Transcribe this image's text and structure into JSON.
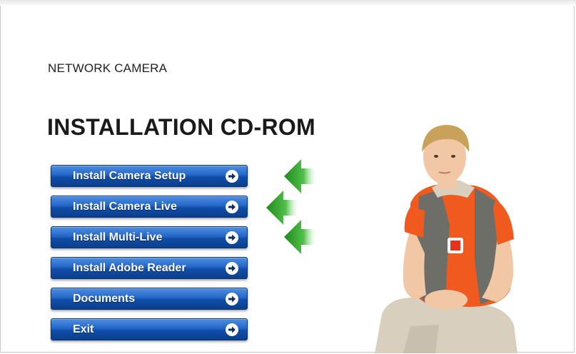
{
  "header": {
    "subtitle": "NETWORK CAMERA",
    "title": "INSTALLATION CD-ROM"
  },
  "menu": {
    "items": [
      {
        "label": "Install Camera Setup",
        "icon": "arrow-right-icon"
      },
      {
        "label": "Install Camera Live",
        "icon": "arrow-right-icon"
      },
      {
        "label": "Install Multi-Live",
        "icon": "arrow-right-icon"
      },
      {
        "label": "Install Adobe Reader",
        "icon": "arrow-right-icon"
      },
      {
        "label": "Documents",
        "icon": "arrow-right-icon"
      },
      {
        "label": "Exit",
        "icon": "arrow-right-icon"
      }
    ]
  },
  "decorations": {
    "green_arrows": [
      "green-arrow-left-icon",
      "green-arrow-left-icon",
      "green-arrow-left-icon"
    ],
    "photo": "boy-portrait"
  },
  "colors": {
    "button_blue": "#1c5bbf",
    "arrow_green": "#3aa336",
    "title_text": "#1a1a1a"
  }
}
